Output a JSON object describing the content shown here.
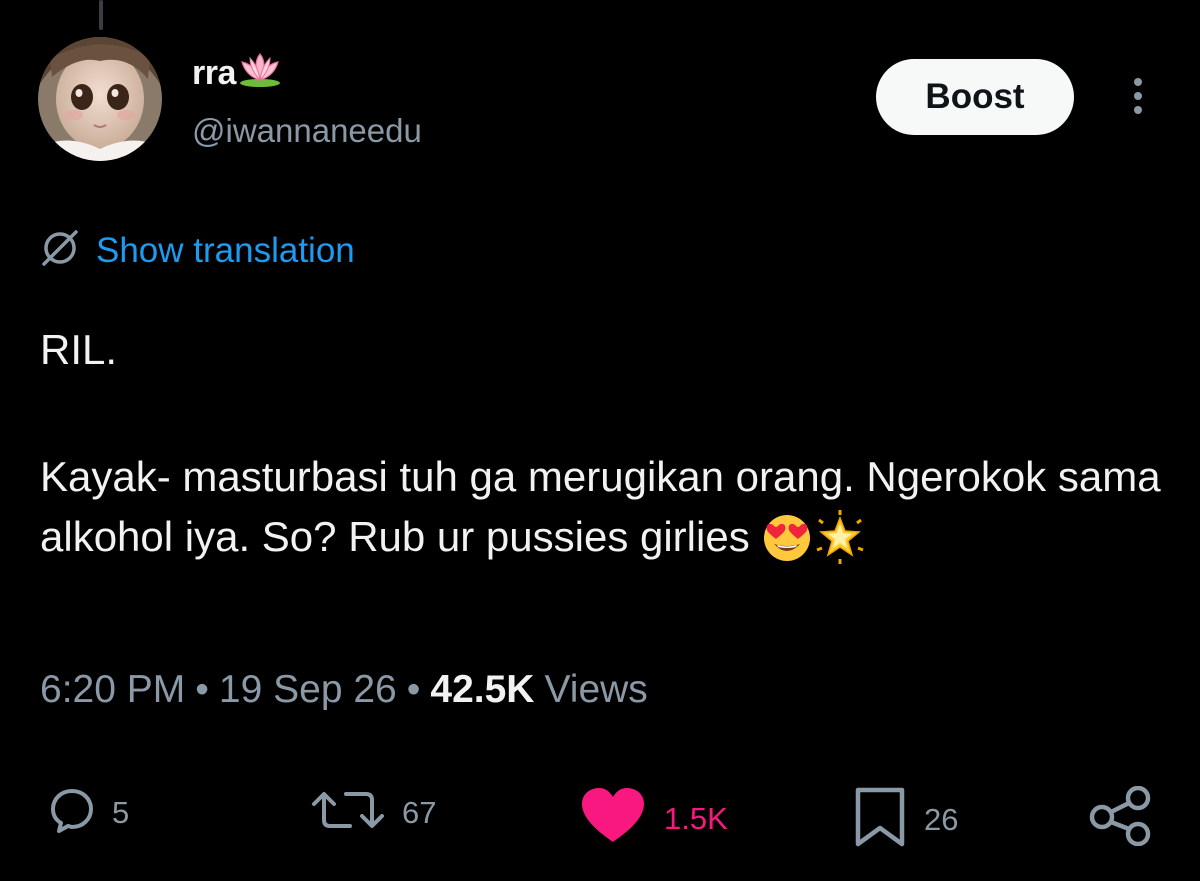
{
  "post": {
    "author": {
      "display_name": "rra",
      "name_emoji": "lotus",
      "handle": "@iwannaneedu"
    },
    "boost_label": "Boost",
    "translation_label": "Show translation",
    "text_line_1": "RIL.",
    "text_paragraph_2": "Kayak- masturbasi tuh ga merugikan orang. Ngerokok sama alkohol iya. So? Rub ur pussies girlies",
    "text_emojis": [
      "smiling-face-with-heart-eyes",
      "glowing-star"
    ],
    "time": "6:20 PM",
    "date": "19 Sep 26",
    "separator": "•",
    "views_count": "42.5K",
    "views_label": "Views"
  },
  "actions": {
    "reply_count": "5",
    "repost_count": "67",
    "like_count": "1.5K",
    "bookmark_count": "26",
    "liked": true
  },
  "colors": {
    "background": "#000000",
    "text_primary": "#e7e9ea",
    "text_secondary": "#8b98a5",
    "link": "#1d9bf0",
    "like": "#f91880",
    "button_bg": "#f7f9f9"
  }
}
